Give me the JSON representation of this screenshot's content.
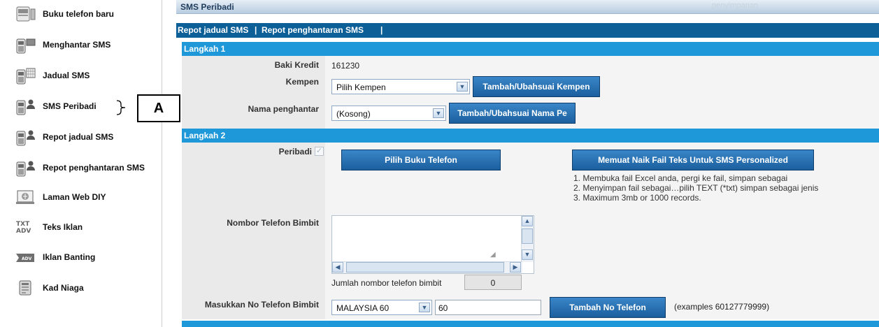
{
  "sidebar": {
    "items": [
      {
        "label": "Buku telefon baru",
        "icon": "phonebook-icon"
      },
      {
        "label": "Menghantar SMS",
        "icon": "send-sms-icon"
      },
      {
        "label": "Jadual SMS",
        "icon": "sms-schedule-icon"
      },
      {
        "label": "SMS Peribadi",
        "icon": "personal-sms-icon"
      },
      {
        "label": "Repot jadual SMS",
        "icon": "schedule-report-icon"
      },
      {
        "label": "Repot penghantaran SMS",
        "icon": "delivery-report-icon"
      },
      {
        "label": "Laman Web DIY",
        "icon": "website-icon"
      },
      {
        "label": "Teks Iklan",
        "icon": "text-ad-icon"
      },
      {
        "label": "Iklan Banting",
        "icon": "banner-ad-icon"
      },
      {
        "label": "Kad Niaga",
        "icon": "business-card-icon"
      }
    ]
  },
  "annotation": {
    "label": "A"
  },
  "header": {
    "title": "SMS Peribadi",
    "right_text": "penyimpanan"
  },
  "report_links": {
    "schedule": "Repot jadual SMS",
    "separator1": " | ",
    "delivery": "Repot penghantaran SMS",
    "separator2": " |"
  },
  "step1": {
    "title": "Langkah 1",
    "credit_label": "Baki Kredit",
    "credit_value": "161230",
    "campaign_label": "Kempen",
    "campaign_selected": "Pilih Kempen",
    "campaign_button": "Tambah/Ubahsuai Kempen",
    "sender_label": "Nama penghantar",
    "sender_selected": "(Kosong)",
    "sender_button": "Tambah/Ubahsuai Nama Pe"
  },
  "step2": {
    "title": "Langkah 2",
    "personal_label": "Peribadi",
    "personal_checked": true,
    "phonebook_button": "Pilih Buku Telefon",
    "upload_button": "Memuat Naik Fail Teks Untuk SMS Personalized",
    "instructions": [
      "1.  Membuka fail Excel anda, pergi ke fail, simpan sebagai",
      "2.  Menyimpan fail sebagai…pilih TEXT (*txt) simpan sebagai jenis",
      "3.  Maximum 3mb or 1000 records."
    ],
    "mobile_label": "Nombor Telefon Bimbit",
    "mobile_value": "",
    "count_label": "Jumlah nombor telefon bimbit",
    "count_value": "0",
    "add_label": "Masukkan No Telefon Bimbit",
    "country_selected": "MALAYSIA 60",
    "number_value": "60",
    "add_button": "Tambah No Telefon",
    "example_text": "(examples 60127779999)"
  }
}
